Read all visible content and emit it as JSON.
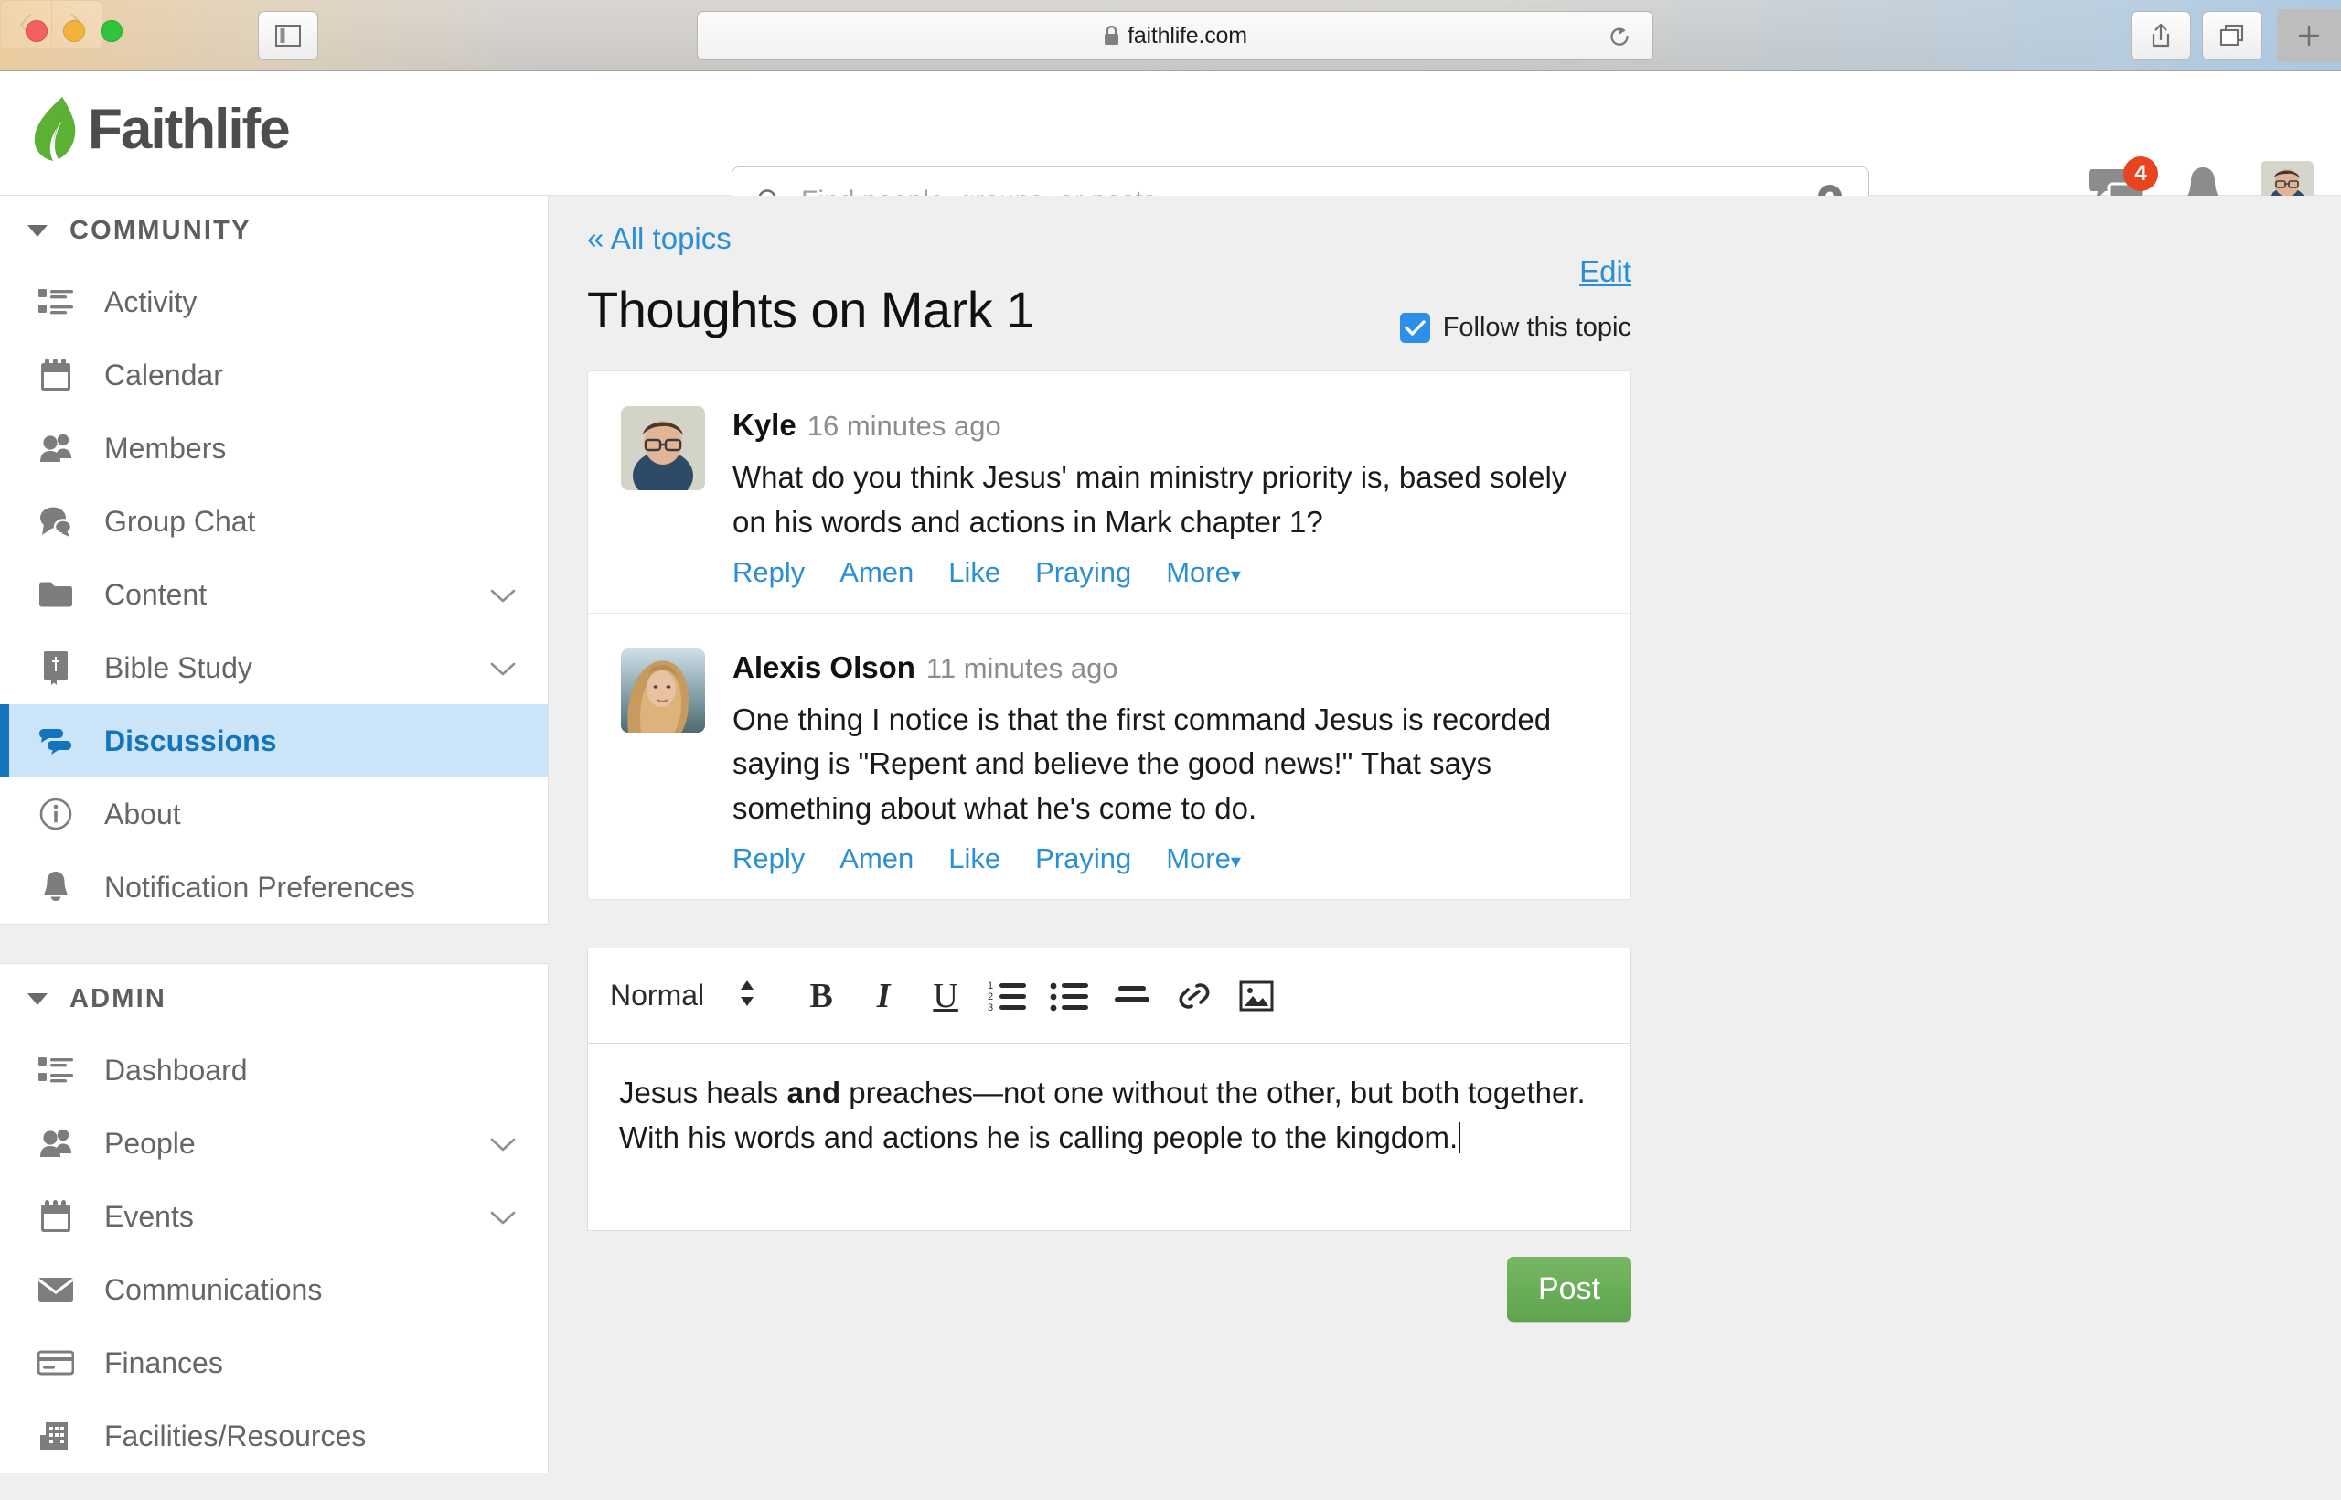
{
  "browser": {
    "url": "faithlife.com",
    "lock_icon": "lock-icon",
    "back_icon": "chevron-left-icon",
    "forward_icon": "chevron-right-icon",
    "sidebar_toggle_icon": "sidebar-toggle-icon",
    "reload_icon": "reload-icon",
    "share_icon": "share-icon",
    "tabs_icon": "tabs-icon",
    "new_tab_icon": "plus-icon"
  },
  "header": {
    "logo_text": "Faithlife",
    "logo_icon": "faithlife-leaf-icon",
    "search": {
      "placeholder": "Find people, groups, or posts",
      "value": "",
      "search_icon": "search-icon",
      "location_icon": "location-pin-icon"
    },
    "messages": {
      "icon": "chat-bubbles-icon",
      "badge": "4"
    },
    "notifications": {
      "icon": "bell-icon"
    },
    "avatar": {
      "icon": "user-avatar"
    }
  },
  "sidebar": {
    "sections": [
      {
        "title": "COMMUNITY",
        "caret_icon": "caret-down-icon",
        "items": [
          {
            "label": "Activity",
            "icon": "list-icon",
            "active": false,
            "chevron": false
          },
          {
            "label": "Calendar",
            "icon": "calendar-icon",
            "active": false,
            "chevron": false
          },
          {
            "label": "Members",
            "icon": "people-icon",
            "active": false,
            "chevron": false
          },
          {
            "label": "Group Chat",
            "icon": "chat-icon",
            "active": false,
            "chevron": false
          },
          {
            "label": "Content",
            "icon": "folder-icon",
            "active": false,
            "chevron": true
          },
          {
            "label": "Bible Study",
            "icon": "bible-icon",
            "active": false,
            "chevron": true
          },
          {
            "label": "Discussions",
            "icon": "discussions-icon",
            "active": true,
            "chevron": false
          },
          {
            "label": "About",
            "icon": "info-icon",
            "active": false,
            "chevron": false
          },
          {
            "label": "Notification Preferences",
            "icon": "bell-icon",
            "active": false,
            "chevron": false
          }
        ]
      },
      {
        "title": "ADMIN",
        "caret_icon": "caret-down-icon",
        "items": [
          {
            "label": "Dashboard",
            "icon": "list-icon",
            "active": false,
            "chevron": false
          },
          {
            "label": "People",
            "icon": "people-icon",
            "active": false,
            "chevron": true
          },
          {
            "label": "Events",
            "icon": "calendar-icon",
            "active": false,
            "chevron": true
          },
          {
            "label": "Communications",
            "icon": "envelope-icon",
            "active": false,
            "chevron": false
          },
          {
            "label": "Finances",
            "icon": "card-icon",
            "active": false,
            "chevron": false
          },
          {
            "label": "Facilities/Resources",
            "icon": "building-icon",
            "active": false,
            "chevron": false
          }
        ]
      }
    ]
  },
  "main": {
    "breadcrumb": "« All topics",
    "title": "Thoughts on Mark 1",
    "edit_label": "Edit",
    "follow_label": "Follow this topic",
    "follow_checked": true,
    "check_icon": "checkmark-icon",
    "posts": [
      {
        "author": "Kyle",
        "time": "16 minutes ago",
        "text": "What do you think Jesus' main ministry priority is, based solely on his words and actions in Mark chapter 1?",
        "actions": [
          "Reply",
          "Amen",
          "Like",
          "Praying",
          "More"
        ]
      },
      {
        "author": "Alexis Olson",
        "time": "11 minutes ago",
        "text": "One thing I notice is that the first command Jesus is recorded saying is \"Repent and believe the good news!\" That says something about what he's come to do.",
        "actions": [
          "Reply",
          "Amen",
          "Like",
          "Praying",
          "More"
        ]
      }
    ],
    "editor": {
      "format_label": "Normal",
      "format_caret_icon": "updown-caret-icon",
      "toolbar": [
        {
          "name": "bold-button",
          "glyph": "B"
        },
        {
          "name": "italic-button",
          "glyph": "I"
        },
        {
          "name": "underline-button",
          "glyph": "U"
        },
        {
          "name": "ordered-list-button",
          "glyph": "ordered-list-icon"
        },
        {
          "name": "bullet-list-button",
          "glyph": "bullet-list-icon"
        },
        {
          "name": "align-button",
          "glyph": "align-icon"
        },
        {
          "name": "link-button",
          "glyph": "link-icon"
        },
        {
          "name": "image-button",
          "glyph": "image-icon"
        }
      ],
      "content_part1": "Jesus heals ",
      "content_bold": "and",
      "content_part2": " preaches—not one without the other, but both together. With his words and actions he is calling people to the kingdom.",
      "placeholder": ""
    },
    "post_button_label": "Post"
  },
  "colors": {
    "accent_blue": "#2a8fd4",
    "active_blue": "#1375bc",
    "active_bg": "#cce4f8",
    "badge_red": "#e8441f",
    "post_green": "#5ea44f",
    "logo_green": "#5cb034",
    "page_bg": "#efefef"
  }
}
